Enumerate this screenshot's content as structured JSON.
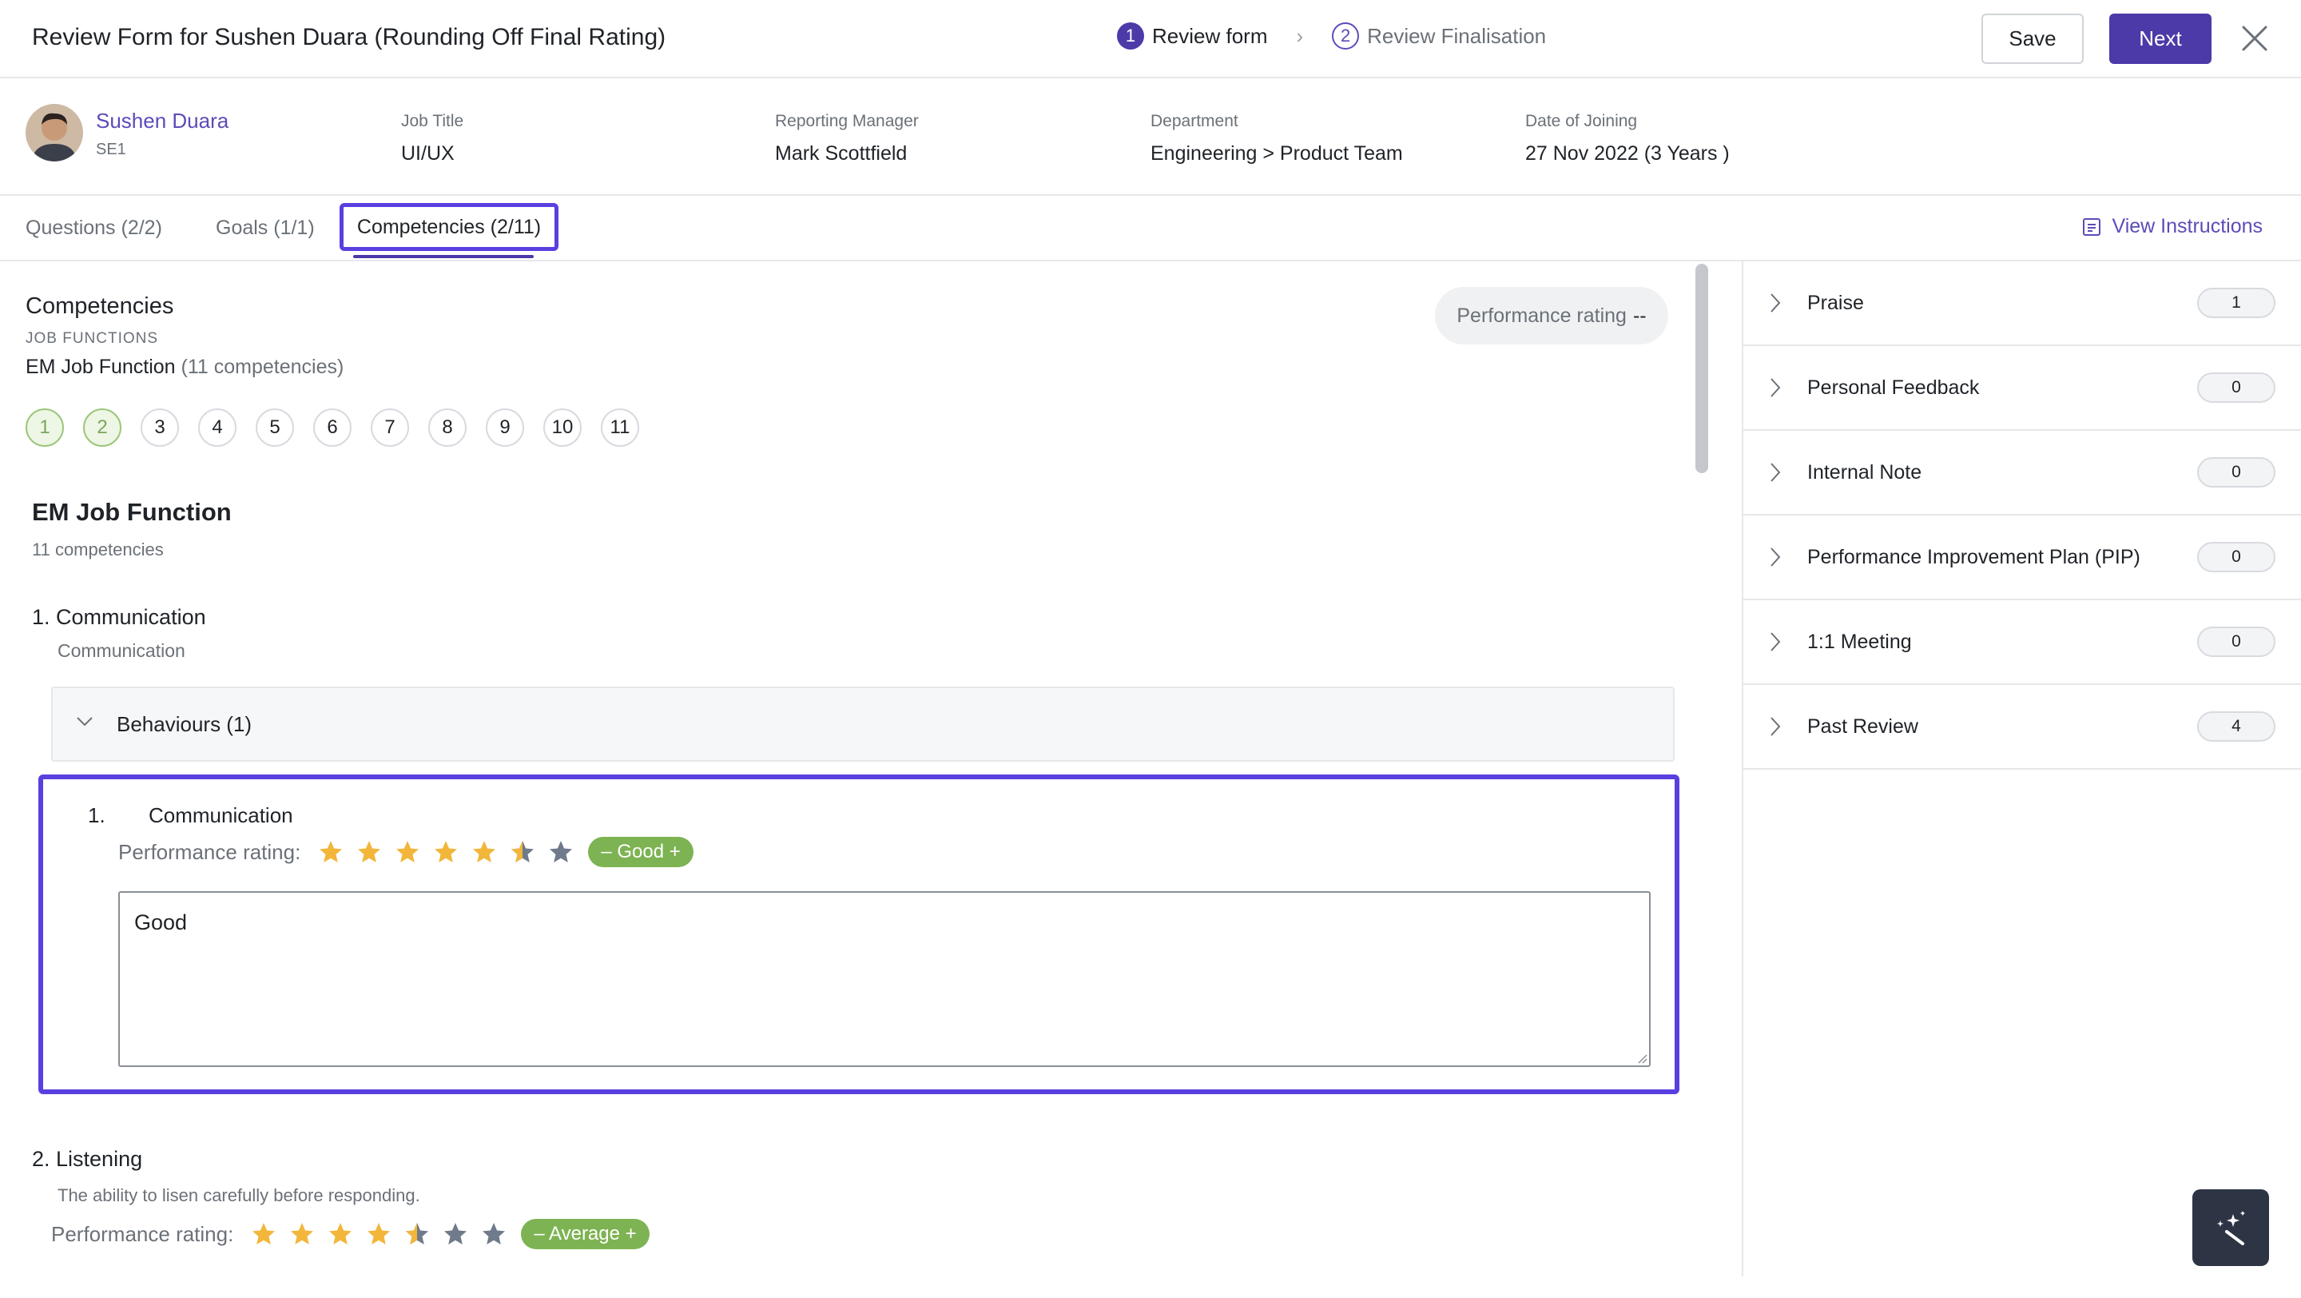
{
  "header": {
    "title": "Review Form for Sushen Duara (Rounding Off Final Rating)",
    "steps": [
      {
        "num": "1",
        "label": "Review form"
      },
      {
        "num": "2",
        "label": "Review Finalisation"
      }
    ],
    "save_label": "Save",
    "next_label": "Next"
  },
  "employee": {
    "name": "Sushen Duara",
    "code": "SE1",
    "fields": [
      {
        "label": "Job Title",
        "value": "UI/UX"
      },
      {
        "label": "Reporting Manager",
        "value": "Mark Scottfield"
      },
      {
        "label": "Department",
        "value": "Engineering > Product Team"
      },
      {
        "label": "Date of Joining",
        "value": "27 Nov 2022 (3 Years )"
      }
    ]
  },
  "tabs": {
    "questions": "Questions (2/2)",
    "goals": "Goals (1/1)",
    "competencies": "Competencies (2/11)",
    "view_instructions": "View Instructions"
  },
  "competencies": {
    "title": "Competencies",
    "job_functions_caption": "JOB FUNCTIONS",
    "job_function_name": "EM Job Function",
    "job_function_count": "(11 competencies)",
    "performance_rating_label": "Performance rating",
    "performance_rating_value": "--",
    "pager": [
      "1",
      "2",
      "3",
      "4",
      "5",
      "6",
      "7",
      "8",
      "9",
      "10",
      "11"
    ],
    "completed_pages": 2
  },
  "section": {
    "title": "EM Job Function",
    "subtitle": "11 competencies"
  },
  "competency_1": {
    "title": "1. Communication",
    "description": "Communication",
    "behaviours_label": "Behaviours (1)",
    "behaviour": {
      "num": "1.",
      "title": "Communication",
      "rating_label": "Performance rating:",
      "rating": 5.5,
      "max": 7,
      "badge": "– Good +",
      "comment": "Good"
    }
  },
  "competency_2": {
    "title": "2. Listening",
    "description": "The ability to lisen carefully before responding.",
    "rating_label": "Performance rating:",
    "rating": 4.5,
    "max": 7,
    "badge": "– Average +"
  },
  "sidebar": {
    "items": [
      {
        "label": "Praise",
        "count": "1"
      },
      {
        "label": "Personal Feedback",
        "count": "0"
      },
      {
        "label": "Internal Note",
        "count": "0"
      },
      {
        "label": "Performance Improvement Plan (PIP)",
        "count": "0"
      },
      {
        "label": "1:1 Meeting",
        "count": "0"
      },
      {
        "label": "Past Review",
        "count": "4"
      }
    ]
  },
  "colors": {
    "accent": "#4b3aa8",
    "highlight": "#5a3fe0",
    "star_filled": "#f2b63a",
    "star_empty": "#6f7a8a",
    "badge_green": "#7db352"
  }
}
